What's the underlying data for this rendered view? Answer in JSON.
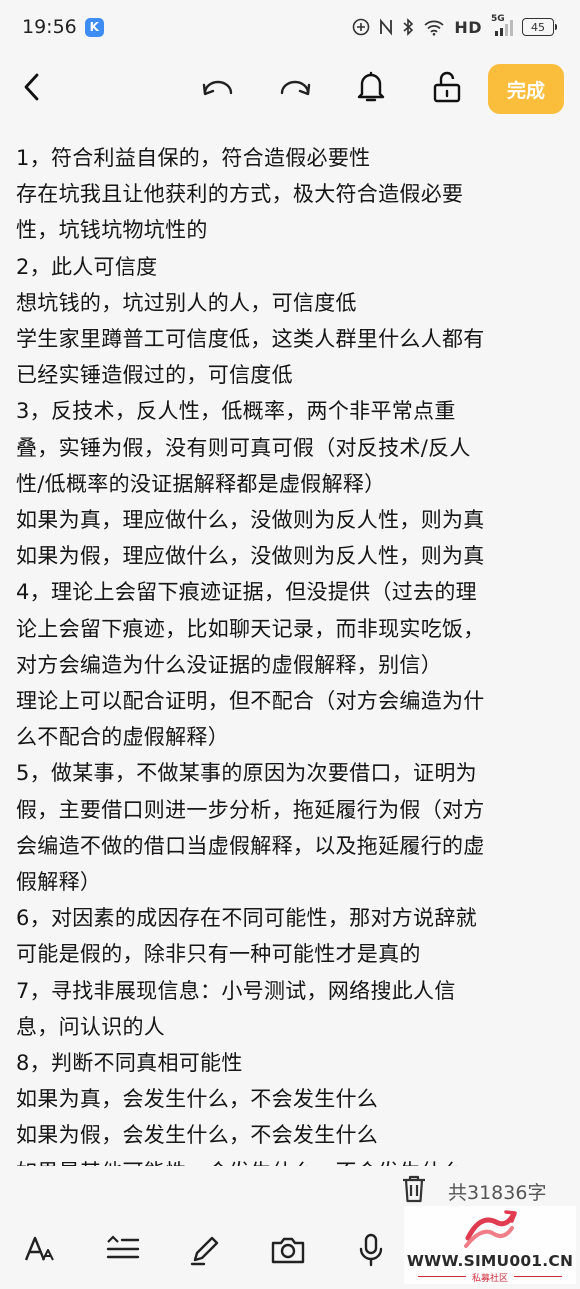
{
  "status_bar": {
    "time": "19:56",
    "app_badge": "K",
    "network": "HD",
    "signal_gen": "5G",
    "battery": "45"
  },
  "toolbar": {
    "done_label": "完成"
  },
  "note": {
    "lines": [
      "1，符合利益自保的，符合造假必要性",
      "存在坑我且让他获利的方式，极大符合造假必要",
      "性，坑钱坑物坑性的",
      "2，此人可信度",
      "想坑钱的，坑过别人的人，可信度低",
      "学生家里蹲普工可信度低，这类人群里什么人都有",
      "已经实锤造假过的，可信度低",
      "3，反技术，反人性，低概率，两个非平常点重",
      "叠，实锤为假，没有则可真可假（对反技术/反人",
      "性/低概率的没证据解释都是虚假解释）",
      "如果为真，理应做什么，没做则为反人性，则为真",
      "如果为假，理应做什么，没做则为反人性，则为真",
      "4，理论上会留下痕迹证据，但没提供（过去的理",
      "论上会留下痕迹，比如聊天记录，而非现实吃饭，",
      "对方会编造为什么没证据的虚假解释，别信）",
      "理论上可以配合证明，但不配合（对方会编造为什",
      "么不配合的虚假解释）",
      "5，做某事，不做某事的原因为次要借口，证明为",
      "假，主要借口则进一步分析，拖延履行为假（对方",
      "会编造不做的借口当虚假解释，以及拖延履行的虚",
      "假解释）",
      "6，对因素的成因存在不同可能性，那对方说辞就",
      "可能是假的，除非只有一种可能性才是真的",
      "7，寻找非展现信息：小号测试，网络搜此人信",
      "息，问认识的人",
      "8，判断不同真相可能性",
      "如果为真，会发生什么，不会发生什么",
      "如果为假，会发生什么，不会发生什么",
      "如果是其他可能性，会发生什么，不会发生什么"
    ]
  },
  "footer": {
    "word_count": "共31836字"
  },
  "watermark": {
    "site": "WWW.SIMU001.CN",
    "subtitle": "私募社区"
  },
  "icons": {
    "back": "back-icon",
    "undo": "undo-icon",
    "redo": "redo-icon",
    "reminder": "bell-icon",
    "lock": "unlock-icon",
    "delete": "trash-icon",
    "font": "font-style-icon",
    "format": "paragraph-icon",
    "draw": "pen-icon",
    "camera": "camera-icon",
    "voice": "microphone-icon"
  },
  "colors": {
    "accent": "#fbbd3c",
    "background": "#f6f6f6",
    "text": "#161616"
  }
}
